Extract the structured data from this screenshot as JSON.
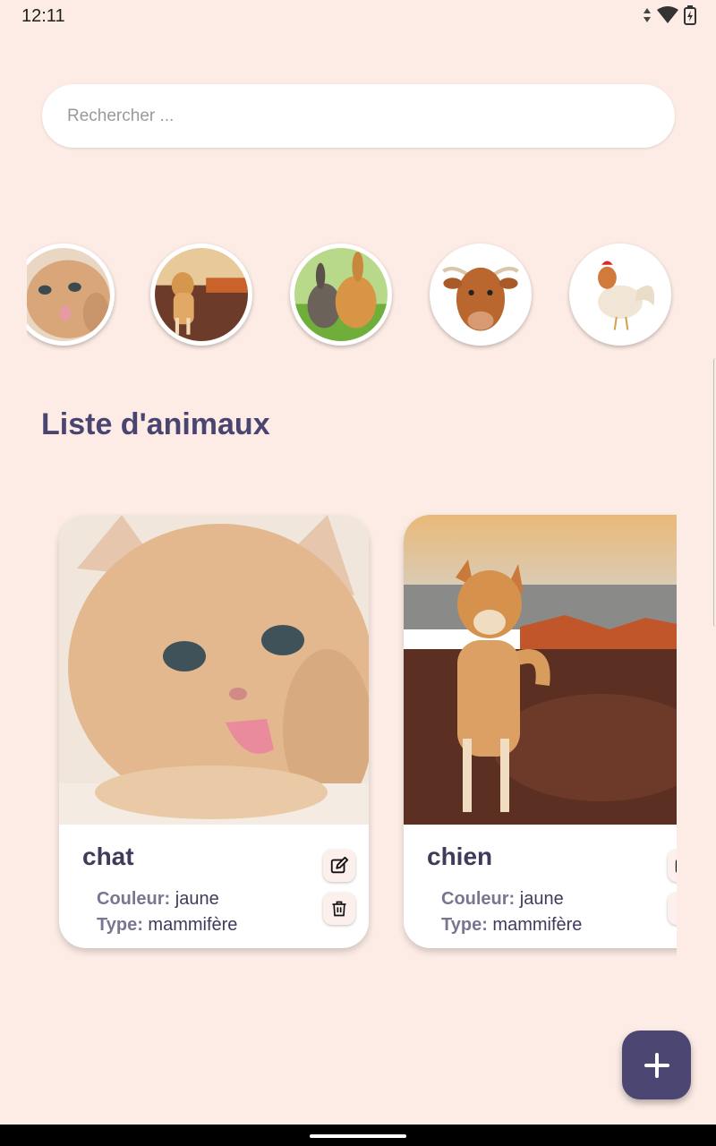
{
  "status_bar": {
    "time": "12:11",
    "icons": [
      "data-arrows-icon",
      "wifi-icon",
      "battery-charging-icon"
    ]
  },
  "search": {
    "placeholder": "Rechercher ..."
  },
  "stories": [
    {
      "animal": "chat",
      "icon": "cat-thumbnail"
    },
    {
      "animal": "chien",
      "icon": "dog-thumbnail"
    },
    {
      "animal": "lapin",
      "icon": "rabbit-thumbnail"
    },
    {
      "animal": "vache",
      "icon": "cow-thumbnail"
    },
    {
      "animal": "coq",
      "icon": "rooster-thumbnail"
    }
  ],
  "list": {
    "title": "Liste d'animaux",
    "cards": [
      {
        "name": "chat",
        "color_label": "Couleur:",
        "color_value": "jaune",
        "type_label": "Type:",
        "type_value": "mammifère"
      },
      {
        "name": "chien",
        "color_label": "Couleur:",
        "color_value": "jaune",
        "type_label": "Type:",
        "type_value": "mammifère"
      }
    ]
  },
  "fab": {
    "icon": "plus-icon"
  },
  "colors": {
    "background": "#fdece6",
    "accent": "#4b4672",
    "title": "#4a4470"
  }
}
